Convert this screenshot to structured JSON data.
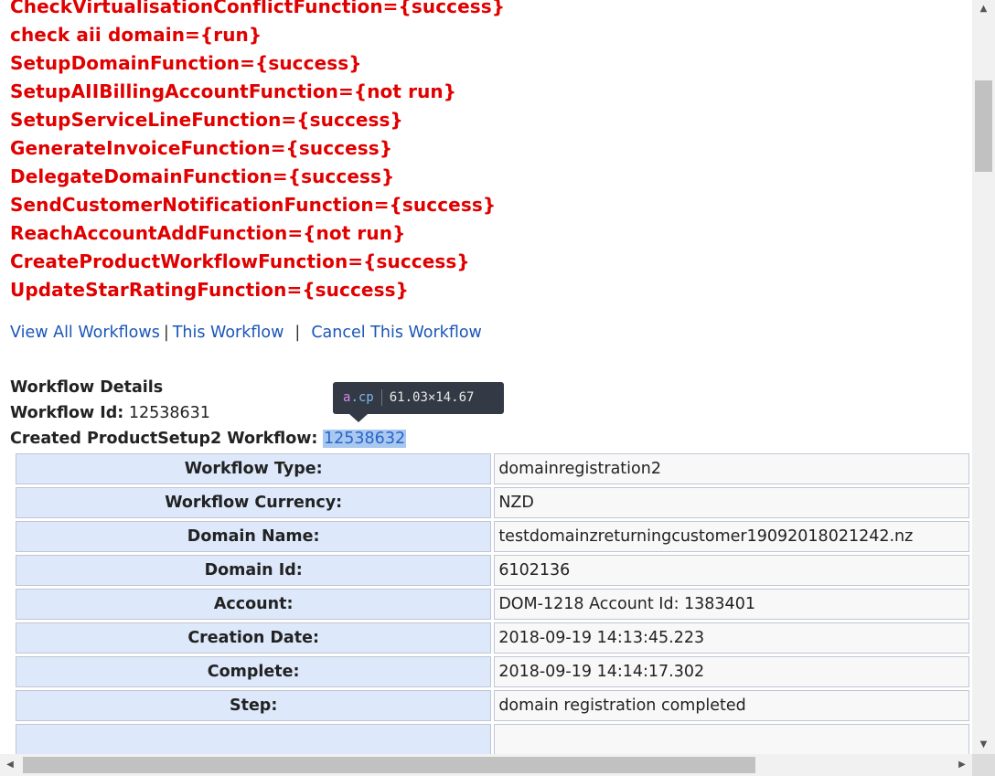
{
  "functions": [
    "CheckVirtualisationConflictFunction={success}",
    "check aii domain={run}",
    "SetupDomainFunction={success}",
    "SetupAIIBillingAccountFunction={not run}",
    "SetupServiceLineFunction={success}",
    "GenerateInvoiceFunction={success}",
    "DelegateDomainFunction={success}",
    "SendCustomerNotificationFunction={success}",
    "ReachAccountAddFunction={not run}",
    "CreateProductWorkflowFunction={success}",
    "UpdateStarRatingFunction={success}"
  ],
  "links": {
    "view_all": "View All Workflows",
    "sep1": "|",
    "this_workflow": "This Workflow",
    "sep2": "|",
    "cancel": "Cancel This Workflow"
  },
  "details": {
    "heading": "Workflow Details",
    "workflow_id_label": "Workflow Id:",
    "workflow_id": "12538631",
    "created_label": "Created ProductSetup2 Workflow:",
    "created_id": "12538632"
  },
  "tooltip": {
    "tag": "a",
    "cls": ".cp",
    "size": "61.03×14.67"
  },
  "table": [
    {
      "label": "Workflow Type:",
      "value": "domainregistration2"
    },
    {
      "label": "Workflow Currency:",
      "value": "NZD"
    },
    {
      "label": "Domain Name:",
      "value": "testdomainzreturningcustomer19092018021242.nz"
    },
    {
      "label": "Domain Id:",
      "value": "6102136"
    },
    {
      "label": "Account:",
      "value": "DOM-1218 Account Id: 1383401"
    },
    {
      "label": "Creation Date:",
      "value": "2018-09-19 14:13:45.223"
    },
    {
      "label": "Complete:",
      "value": "2018-09-19 14:14:17.302"
    },
    {
      "label": "Step:",
      "value": "domain registration completed"
    },
    {
      "label": "",
      "value": ""
    }
  ],
  "colors": {
    "function_text": "#e00000",
    "link": "#1a56b8",
    "label_cell_bg": "#dde9fb"
  }
}
